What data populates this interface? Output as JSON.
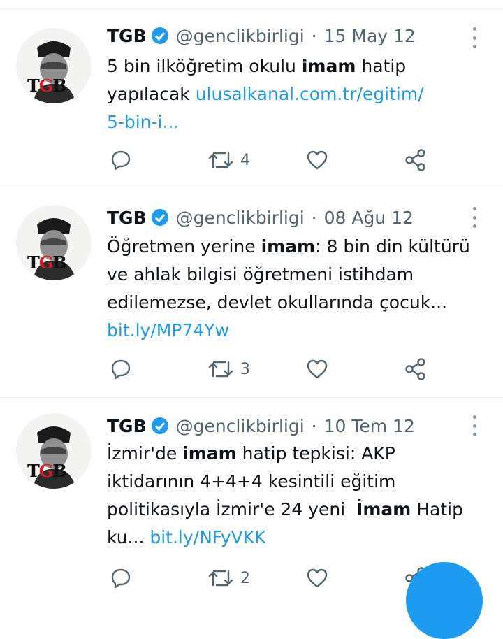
{
  "accent_color": "#1d9bf0",
  "tweets": [
    {
      "name": "TGB",
      "handle": "@genclikbirligi",
      "separator": "·",
      "date": "15 May 12",
      "text_before": "5 bin ilköğretim okulu ",
      "text_bold": "imam",
      "text_after": " hatip\nyapılacak ",
      "link": "ulusalkanal.com.tr/egitim/\n5-bin-i...",
      "retweet_count": "4"
    },
    {
      "name": "TGB",
      "handle": "@genclikbirligi",
      "separator": "·",
      "date": "08 Ağu 12",
      "text_before": "Öğretmen yerine ",
      "text_bold": "imam",
      "text_after": ": 8 bin din kültürü\nve ahlak bilgisi öğretmeni istihdam\nedilemezse, devlet okullarında çocuk...\n",
      "link": "bit.ly/MP74Yw",
      "retweet_count": "3"
    },
    {
      "name": "TGB",
      "handle": "@genclikbirligi",
      "separator": "·",
      "date": "10 Tem 12",
      "text_before": "İzmir'de ",
      "text_bold": "imam",
      "text_mid": " hatip tepkisi: AKP\niktidarının 4+4+4 kesintili eğitim\npolitikasıyla İzmir'e 24 yeni  ",
      "text_bold2": "İmam",
      "text_after": " Hatip\nku... ",
      "link": "bit.ly/NFyVKK",
      "retweet_count": "2"
    }
  ],
  "avatar": {
    "logo_text_t": "T",
    "logo_text_g": "G",
    "logo_text_b": "B"
  }
}
